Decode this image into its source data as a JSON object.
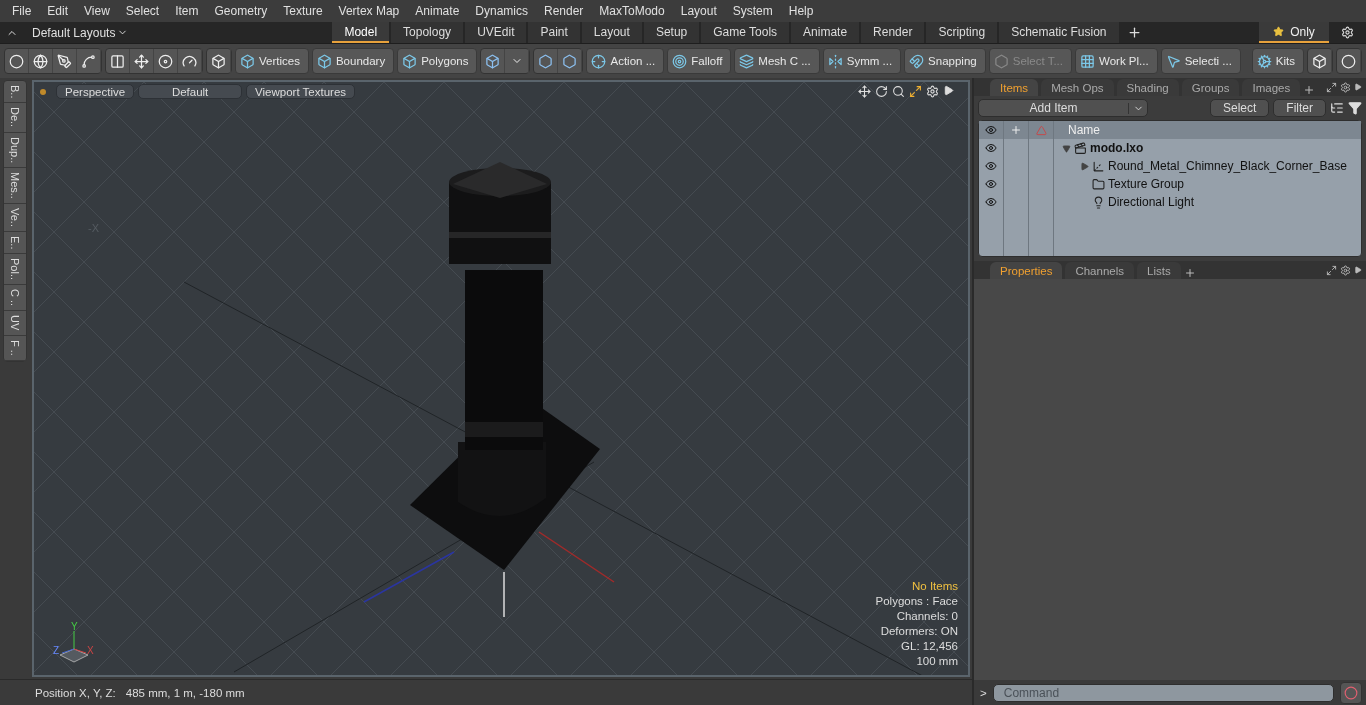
{
  "menu": [
    "File",
    "Edit",
    "View",
    "Select",
    "Item",
    "Geometry",
    "Texture",
    "Vertex Map",
    "Animate",
    "Dynamics",
    "Render",
    "MaxToModo",
    "Layout",
    "System",
    "Help"
  ],
  "layout_bar": {
    "layouts_label": "Default Layouts",
    "tabs": [
      {
        "label": "Model",
        "selected": true
      },
      {
        "label": "Topology",
        "selected": false
      },
      {
        "label": "UVEdit",
        "selected": false
      },
      {
        "label": "Paint",
        "selected": false
      },
      {
        "label": "Layout",
        "selected": false
      },
      {
        "label": "Setup",
        "selected": false
      },
      {
        "label": "Game Tools",
        "selected": false
      },
      {
        "label": "Animate",
        "selected": false
      },
      {
        "label": "Render",
        "selected": false
      },
      {
        "label": "Scripting",
        "selected": false
      },
      {
        "label": "Schematic Fusion",
        "selected": false
      }
    ],
    "only_label": "Only"
  },
  "toolbar": [
    {
      "label": "Vertices",
      "kind": "vertices",
      "disabled": false
    },
    {
      "label": "Boundary",
      "kind": "boundary",
      "disabled": false
    },
    {
      "label": "Polygons",
      "kind": "polygons",
      "disabled": false
    },
    {
      "label": "Action ...",
      "kind": "action",
      "disabled": false
    },
    {
      "label": "Falloff",
      "kind": "falloff",
      "disabled": false
    },
    {
      "label": "Mesh C ...",
      "kind": "mesh",
      "disabled": false
    },
    {
      "label": "Symm ...",
      "kind": "symmetry",
      "disabled": false
    },
    {
      "label": "Snapping",
      "kind": "snapping",
      "disabled": false
    },
    {
      "label": "Select T...",
      "kind": "select",
      "disabled": true
    },
    {
      "label": "Work Pl...",
      "kind": "workplane",
      "disabled": false
    },
    {
      "label": "Selecti ...",
      "kind": "selection",
      "disabled": false
    },
    {
      "label": "Kits",
      "kind": "kits",
      "disabled": false
    }
  ],
  "side_tabs": [
    "B..",
    "De..",
    "Dup..",
    "Mes..",
    "Ve..",
    "E..",
    "Pol..",
    "C ..",
    "UV",
    "F .."
  ],
  "viewport": {
    "buttons": [
      "Perspective",
      "Default",
      "Viewport Textures"
    ],
    "axis_label": "-X",
    "info": [
      {
        "text": "No Items",
        "kind": "highlight"
      },
      {
        "text": "Polygons : Face",
        "kind": "normal"
      },
      {
        "text": "Channels: 0",
        "kind": "normal"
      },
      {
        "text": "Deformers: ON",
        "kind": "normal"
      },
      {
        "text": "GL: 12,456",
        "kind": "normal"
      },
      {
        "text": "100 mm",
        "kind": "normal"
      }
    ],
    "gizmo": {
      "x": "X",
      "y": "Y",
      "z": "Z"
    }
  },
  "items_panel": {
    "tabs": [
      {
        "label": "Items",
        "selected": true
      },
      {
        "label": "Mesh Ops",
        "selected": false
      },
      {
        "label": "Shading",
        "selected": false
      },
      {
        "label": "Groups",
        "selected": false
      },
      {
        "label": "Images",
        "selected": false
      }
    ],
    "add_item": "Add Item",
    "buttons": [
      "Select",
      "Filter"
    ],
    "column": "Name",
    "tree": [
      {
        "name": "modo.lxo",
        "kind": "scene",
        "expanded": true,
        "children": [
          {
            "name": "Round_Metal_Chimney_Black_Corner_Base",
            "kind": "mesh",
            "expanded": false
          },
          {
            "name": "Texture Group",
            "kind": "group"
          },
          {
            "name": "Directional Light",
            "kind": "light"
          }
        ]
      }
    ]
  },
  "properties_panel": {
    "tabs": [
      {
        "label": "Properties",
        "selected": true
      },
      {
        "label": "Channels",
        "selected": false
      },
      {
        "label": "Lists",
        "selected": false
      }
    ]
  },
  "status_bar": {
    "label": "Position X, Y, Z:",
    "value": "485 mm, 1 m, -180 mm"
  },
  "command": {
    "prompt": ">",
    "placeholder": "Command"
  }
}
